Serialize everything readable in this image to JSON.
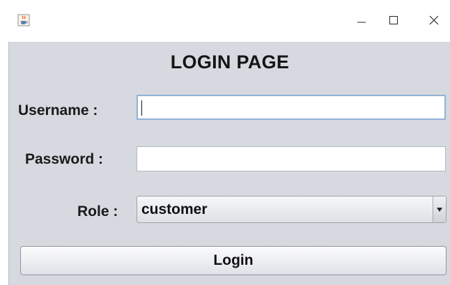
{
  "window": {
    "app_icon": "java-cup-icon",
    "controls": {
      "minimize_icon": "minimize-icon",
      "maximize_icon": "maximize-icon",
      "close_icon": "close-icon"
    }
  },
  "form": {
    "title": "LOGIN PAGE",
    "username_label": "Username :",
    "username_value": "",
    "password_label": "Password :",
    "password_value": "",
    "role_label": "Role :",
    "role_selected": "customer",
    "role_dropdown_icon": "dropdown-arrow-icon",
    "login_button": "Login"
  },
  "colors": {
    "panel_background": "#d6d9df",
    "focus_border": "#8fb1d7"
  }
}
